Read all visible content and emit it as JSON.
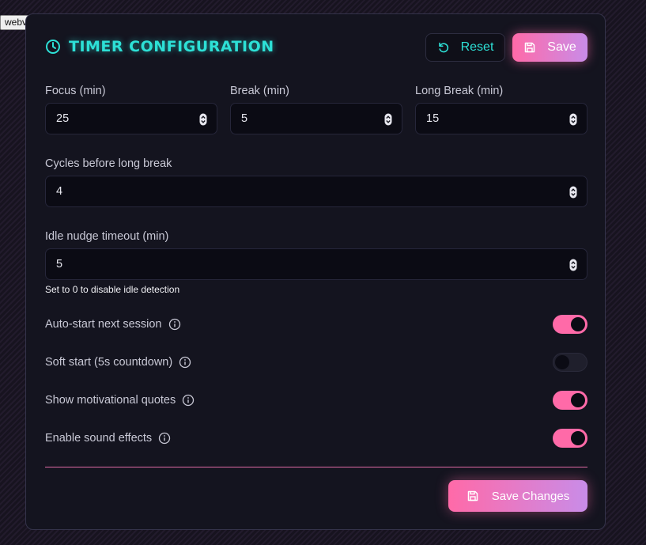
{
  "window_tag": "webview",
  "header": {
    "title": "TIMER CONFIGURATION",
    "reset_label": "Reset",
    "save_label": "Save"
  },
  "fields": {
    "focus": {
      "label": "Focus (min)",
      "value": "25"
    },
    "break": {
      "label": "Break (min)",
      "value": "5"
    },
    "long_break": {
      "label": "Long Break (min)",
      "value": "15"
    },
    "cycles": {
      "label": "Cycles before long break",
      "value": "4"
    },
    "idle": {
      "label": "Idle nudge timeout (min)",
      "value": "5",
      "hint": "Set to 0 to disable idle detection"
    }
  },
  "toggles": [
    {
      "label": "Auto-start next session",
      "on": true
    },
    {
      "label": "Soft start (5s countdown)",
      "on": false
    },
    {
      "label": "Show motivational quotes",
      "on": true
    },
    {
      "label": "Enable sound effects",
      "on": true
    }
  ],
  "footer": {
    "save_changes_label": "Save Changes"
  },
  "colors": {
    "accent_cyan": "#2de0d6",
    "accent_pink": "#ff6aa8",
    "accent_purple": "#c98ce8",
    "panel_bg": "#14141f"
  }
}
